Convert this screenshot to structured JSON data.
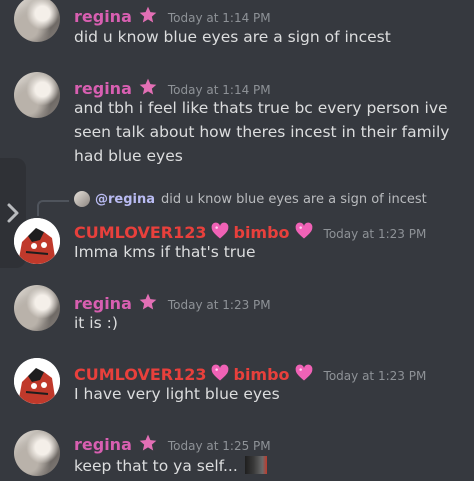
{
  "messages": [
    {
      "author": "regina",
      "timestamp": "Today at 1:14 PM",
      "lines": [
        "did u know blue eyes are a sign of incest"
      ]
    },
    {
      "author": "regina",
      "timestamp": "Today at 1:14 PM",
      "lines": [
        "and tbh i feel like thats true bc every person ive",
        "seen talk about how theres incest in their family",
        "had blue eyes"
      ]
    },
    {
      "reply": {
        "mention": "@regina",
        "text": "did u know blue eyes are a sign of incest"
      },
      "author": "CUMLOVER123",
      "suffix": "bimbo",
      "timestamp": "Today at 1:23 PM",
      "lines": [
        "Imma kms if that's true"
      ]
    },
    {
      "author": "regina",
      "timestamp": "Today at 1:23 PM",
      "lines": [
        "it is :)"
      ]
    },
    {
      "author": "CUMLOVER123",
      "suffix": "bimbo",
      "timestamp": "Today at 1:23 PM",
      "lines": [
        "I have very light blue eyes"
      ]
    },
    {
      "author": "regina",
      "timestamp": "Today at 1:25 PM",
      "lines": [
        "keep that to ya self..."
      ]
    }
  ],
  "icons": {
    "star": "pink-star-icon",
    "heart": "sparkling-heart-icon",
    "side_tab": "chevron-right-icon"
  },
  "colors": {
    "background": "#36393f",
    "regina_name": "#d85fb1",
    "cumlover_name": "#e8403c",
    "timestamp": "#8e9297",
    "message_text": "#dcddde",
    "mention": "#b9bbf2"
  }
}
